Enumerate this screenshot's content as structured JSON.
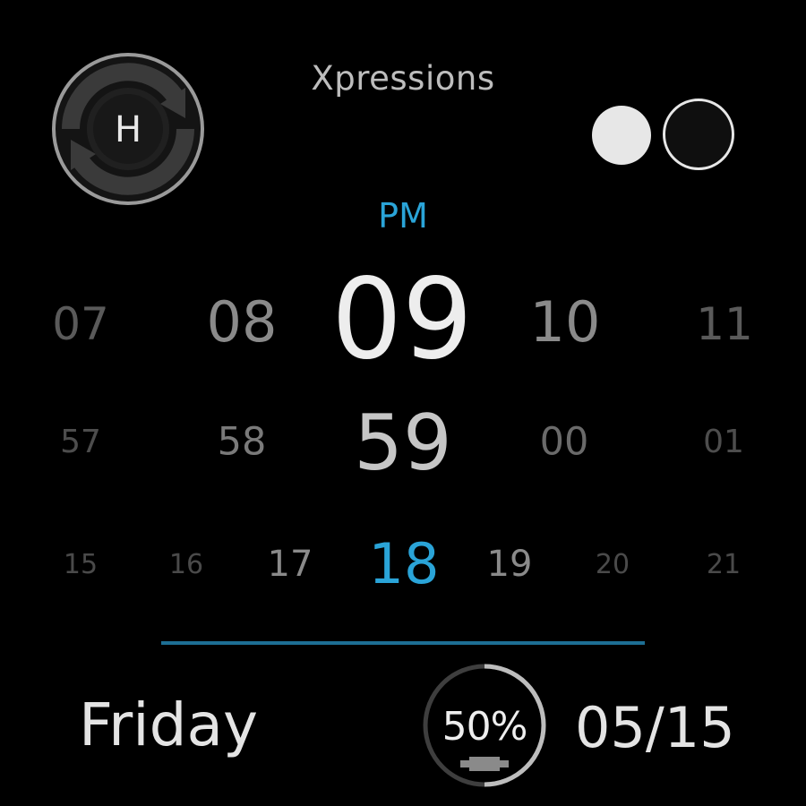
{
  "header": {
    "app_title": "Xpressions",
    "logo_letter": "H"
  },
  "theme_selector": {
    "options": [
      "light",
      "dark"
    ],
    "colors": {
      "light": "#e7e7e7",
      "dark": "#0f0f0f"
    }
  },
  "clock": {
    "ampm": "PM",
    "hours": [
      "07",
      "08",
      "09",
      "10",
      "11"
    ],
    "minutes": [
      "57",
      "58",
      "59",
      "00",
      "01"
    ],
    "seconds": [
      "15",
      "16",
      "17",
      "18",
      "19",
      "20",
      "21"
    ],
    "selected_hour": "09",
    "selected_minute": "59",
    "selected_second": "18"
  },
  "footer": {
    "day": "Friday",
    "date": "05/15",
    "battery_label": "50%",
    "battery_level": 0.5
  },
  "colors": {
    "accent": "#2aa4d8",
    "divider": "#1d6f94",
    "background": "#000000",
    "text": "#e6e6e6"
  },
  "icons": {
    "logo": "h-logo-icon",
    "battery": "battery-icon"
  }
}
